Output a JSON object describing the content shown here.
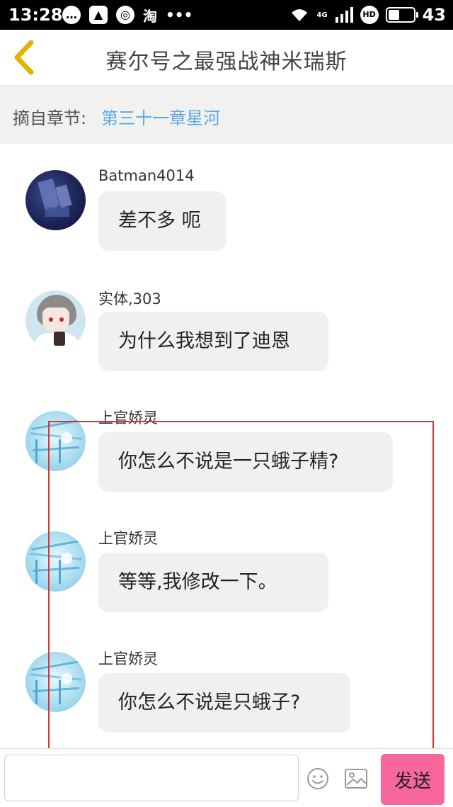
{
  "status_bar": {
    "time": "13:28",
    "app_icon_label": "淘",
    "more": "•••",
    "network": "4G",
    "hd": "HD",
    "battery_percent": "43"
  },
  "header": {
    "title": "赛尔号之最强战神米瑞斯"
  },
  "chapter": {
    "label": "摘自章节:",
    "name": "第三十一章星河"
  },
  "messages": [
    {
      "user": "Batman4014",
      "text": "差不多 呃",
      "avatar": "dark-blue-avatar"
    },
    {
      "user": "实体,303",
      "text": "为什么我想到了迪恩",
      "avatar": "anime-boy-avatar"
    },
    {
      "user": "上官娇灵",
      "text": "你怎么不说是一只蛾子精?",
      "avatar": "anime-girl-avatar"
    },
    {
      "user": "上官娇灵",
      "text": "等等,我修改一下。",
      "avatar": "anime-girl-avatar"
    },
    {
      "user": "上官娇灵",
      "text": "你怎么不说是只蛾子?",
      "avatar": "anime-girl-avatar"
    }
  ],
  "input": {
    "placeholder": "",
    "send_label": "发送"
  },
  "colors": {
    "accent_link": "#5aa7e6",
    "send_button": "#f6679b",
    "back_arrow": "#e1b400",
    "highlight_box": "#d23a3a"
  }
}
